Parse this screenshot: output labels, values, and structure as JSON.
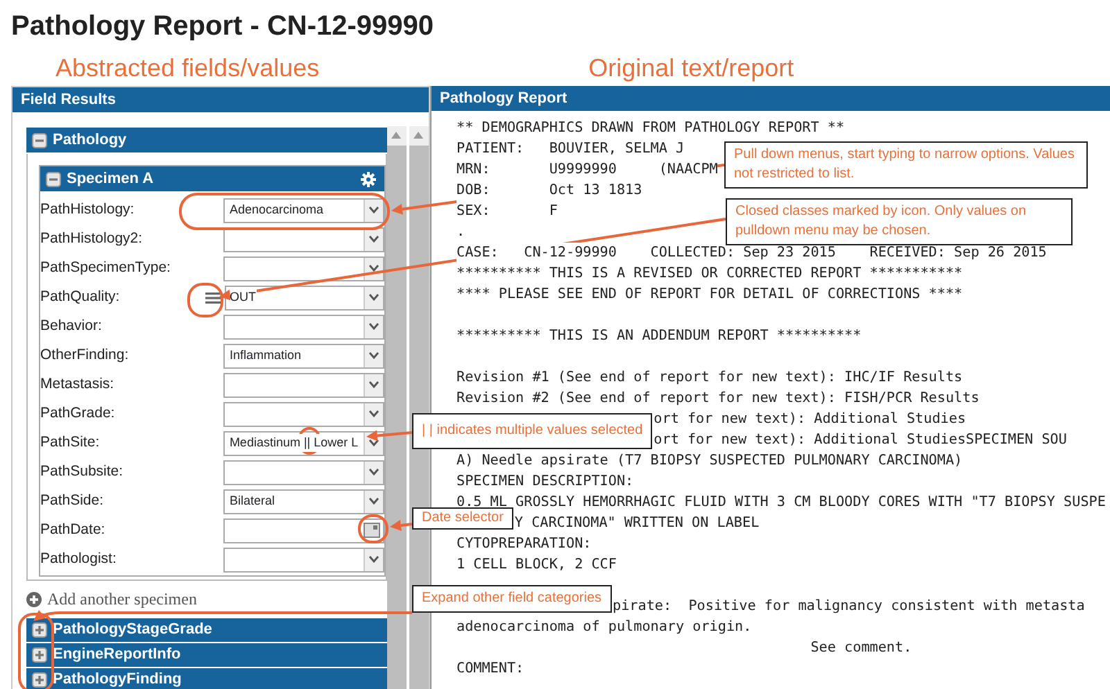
{
  "window": {
    "title": "Pathology Report - CN-12-99990"
  },
  "headings": [
    "Abstracted fields/values",
    "Original text/report"
  ],
  "field_panel": {
    "title": "Field Results",
    "section": {
      "title": "Pathology",
      "expanded": true
    },
    "specimen": {
      "title": "Specimen A",
      "expanded": true,
      "fields": [
        {
          "label": "PathHistology:",
          "kind": "select",
          "value": "Adenocarcinoma",
          "closed_class": false
        },
        {
          "label": "PathHistology2:",
          "kind": "select",
          "closed_class": false
        },
        {
          "label": "PathSpecimenType:",
          "kind": "select",
          "closed_class": false
        },
        {
          "label": "PathQuality:",
          "kind": "select",
          "value": "OUT",
          "closed_class": true
        },
        {
          "label": "Behavior:",
          "kind": "select",
          "closed_class": false
        },
        {
          "label": "OtherFinding:",
          "kind": "select",
          "value": "Inflammation",
          "closed_class": false
        },
        {
          "label": "Metastasis:",
          "kind": "select",
          "closed_class": false
        },
        {
          "label": "PathGrade:",
          "kind": "select",
          "closed_class": false
        },
        {
          "label": "PathSite:",
          "kind": "select",
          "value": "Mediastinum || Lower L",
          "closed_class": false
        },
        {
          "label": "PathSubsite:",
          "kind": "select",
          "closed_class": false
        },
        {
          "label": "PathSide:",
          "kind": "select",
          "value": "Bilateral",
          "closed_class": false
        },
        {
          "label": "PathDate:",
          "kind": "date",
          "closed_class": false
        },
        {
          "label": "Pathologist:",
          "kind": "select",
          "closed_class": false
        }
      ]
    },
    "add_link": "Add another specimen",
    "other_sections": [
      {
        "title": "PathologyStageGrade",
        "expanded": false
      },
      {
        "title": "EngineReportInfo",
        "expanded": false
      },
      {
        "title": "PathologyFinding",
        "expanded": false
      }
    ]
  },
  "report_panel": {
    "title": "Pathology Report",
    "lines": [
      {
        "kind": "text",
        "text": "** DEMOGRAPHICS DRAWN FROM PATHOLOGY REPORT **"
      },
      {
        "kind": "text",
        "text": "PATIENT:   BOUVIER, SELMA J"
      },
      {
        "kind": "text",
        "text": "MRN:       U9999990     (NAACPM"
      },
      {
        "kind": "text",
        "text": "DOB:       Oct 13 1813"
      },
      {
        "kind": "text",
        "text": "SEX:       F"
      },
      {
        "kind": "text",
        "text": "."
      },
      {
        "kind": "text",
        "text": "CASE:   CN-12-99990    COLLECTED: Sep 23 2015    RECEIVED: Sep 26 2015"
      },
      {
        "kind": "text",
        "text": "********** THIS IS A REVISED OR CORRECTED REPORT ***********"
      },
      {
        "kind": "text",
        "text": "**** PLEASE SEE END OF REPORT FOR DETAIL OF CORRECTIONS ****"
      },
      {
        "kind": "blank"
      },
      {
        "kind": "text",
        "text": "********** THIS IS AN ADDENDUM REPORT **********"
      },
      {
        "kind": "blank"
      },
      {
        "kind": "text",
        "text": "Revision #1 (See end of report for new text): IHC/IF Results"
      },
      {
        "kind": "text",
        "text": "Revision #2 (See end of report for new text): FISH/PCR Results"
      },
      {
        "kind": "partial",
        "text": "ort for new text): Additional Studies"
      },
      {
        "kind": "partial",
        "text": "ort for new text): Additional StudiesSPECIMEN SOU"
      },
      {
        "kind": "text",
        "text": "A) Needle apsirate (T7 BIOPSY SUSPECTED PULMONARY CARCINOMA)"
      },
      {
        "kind": "text",
        "text": "SPECIMEN DESCRIPTION:"
      },
      {
        "kind": "text",
        "text": "0.5 ML GROSSLY HEMORRHAGIC FLUID WITH 3 CM BLOODY CORES WITH \"T7 BIOPSY SUSPE"
      },
      {
        "kind": "partial",
        "text": "Y CARCINOMA\" WRITTEN ON LABEL"
      },
      {
        "kind": "text",
        "text": "CYTOPREPARATION:"
      },
      {
        "kind": "text",
        "text": "1 CELL BLOCK, 2 CCF"
      },
      {
        "kind": "blank"
      },
      {
        "kind": "partial",
        "text": "pirate:  Positive for malignancy consistent with metasta"
      },
      {
        "kind": "text",
        "text": "adenocarcinoma of pulmonary origin."
      },
      {
        "kind": "text",
        "text": "                                          See comment."
      },
      {
        "kind": "text",
        "text": "COMMENT:"
      }
    ]
  },
  "callouts": [
    {
      "text": "Pull down menus, start typing to narrow options. Values not restricted to list."
    },
    {
      "text": "Closed classes marked by icon. Only values on pulldown menu may be chosen."
    },
    {
      "text": "| | indicates multiple values selected"
    },
    {
      "text": "Date selector"
    },
    {
      "text": "Expand other field categories"
    }
  ]
}
